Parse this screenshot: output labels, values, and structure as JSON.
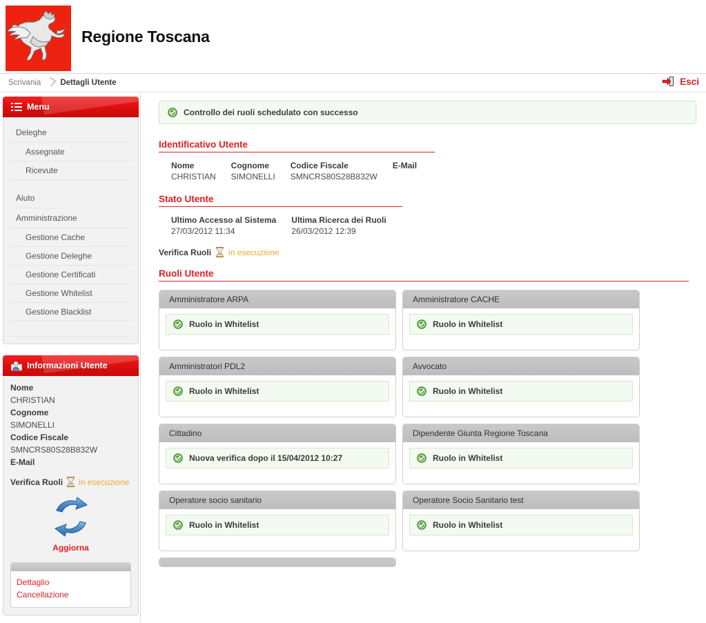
{
  "header": {
    "site_title": "Regione Toscana",
    "logo_icon": "pegasus-logo",
    "logo_bg": "#ee2211"
  },
  "breadcrumb": {
    "home": "Scrivania",
    "separator_icon": "chevron-right-icon",
    "current": "Dettagli Utente"
  },
  "logout": {
    "icon": "exit-door-icon",
    "label": "Esci"
  },
  "sidebar": {
    "menu_panel": {
      "icon": "list-bullet-icon",
      "title": "Menu",
      "items": [
        {
          "label": "Deleghe",
          "level": "group"
        },
        {
          "label": "Assegnate",
          "level": "sub"
        },
        {
          "label": "Ricevute",
          "level": "sub"
        },
        {
          "label": "Aiuto",
          "level": "group"
        },
        {
          "label": "Amministrazione",
          "level": "group"
        },
        {
          "label": "Gestione Cache",
          "level": "sub"
        },
        {
          "label": "Gestione Deleghe",
          "level": "sub"
        },
        {
          "label": "Gestione Certificati",
          "level": "sub"
        },
        {
          "label": "Gestione Whitelist",
          "level": "sub"
        },
        {
          "label": "Gestione Blacklist",
          "level": "sub"
        }
      ]
    },
    "user_panel": {
      "icon": "user-card-icon",
      "title": "Informazioni Utente",
      "fields": [
        {
          "label": "Nome",
          "value": "CHRISTIAN"
        },
        {
          "label": "Cognome",
          "value": "SIMONELLI"
        },
        {
          "label": "Codice Fiscale",
          "value": "SMNCRS80S28B832W"
        },
        {
          "label": "E-Mail",
          "value": ""
        }
      ],
      "verifica": {
        "label": "Verifica Ruoli",
        "icon": "hourglass-icon",
        "state": "in esecuzione",
        "state_color": "#f0a92a"
      },
      "refresh": {
        "icon": "refresh-arrows-icon",
        "label": "Aggiorna"
      },
      "actions": [
        {
          "label": "Dettaglio"
        },
        {
          "label": "Cancellazione"
        }
      ]
    }
  },
  "main": {
    "alert": {
      "icon": "check-circle-icon",
      "text": "Controllo dei ruoli schedulato con successo"
    },
    "identificativo": {
      "title": "Identificativo Utente",
      "headers": [
        "Nome",
        "Cognome",
        "Codice Fiscale",
        "E-Mail"
      ],
      "values": [
        "CHRISTIAN",
        "SIMONELLI",
        "SMNCRS80S28B832W",
        ""
      ]
    },
    "stato": {
      "title": "Stato Utente",
      "headers": [
        "Ultimo Accesso al Sistema",
        "Ultima Ricerca dei Ruoli"
      ],
      "values": [
        "27/03/2012 11:34",
        "26/03/2012 12:39"
      ],
      "verifica": {
        "label": "Verifica Ruoli",
        "icon": "hourglass-icon",
        "state": "in esecuzione"
      }
    },
    "ruoli": {
      "title": "Ruoli Utente",
      "cards": [
        {
          "name": "Amministratore ARPA",
          "status": "Ruolo in Whitelist"
        },
        {
          "name": "Amministratore CACHE",
          "status": "Ruolo in Whitelist"
        },
        {
          "name": "Amministratori PDL2",
          "status": "Ruolo in Whitelist"
        },
        {
          "name": "Avvocato",
          "status": "Ruolo in Whitelist"
        },
        {
          "name": "Cittadino",
          "status": "Nuova verifica dopo il 15/04/2012 10:27"
        },
        {
          "name": "Dipendente Giunta Regione Toscana",
          "status": "Ruolo in Whitelist"
        },
        {
          "name": "Operatore socio sanitario",
          "status": "Ruolo in Whitelist"
        },
        {
          "name": "Operatore Socio Sanitario test",
          "status": "Ruolo in Whitelist"
        }
      ]
    }
  },
  "colors": {
    "brand_red": "#e02020",
    "success_green": "#4a9b36",
    "pending_orange": "#f0a92a",
    "card_header_gray": "#c4c4c4"
  }
}
